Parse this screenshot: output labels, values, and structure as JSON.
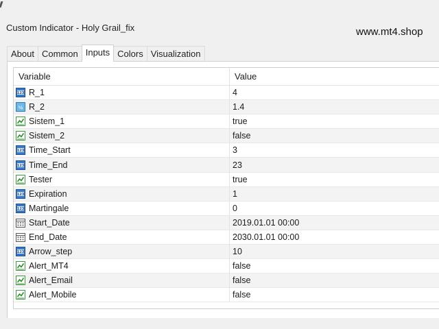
{
  "window": {
    "title": "Custom Indicator - Holy Grail_fix"
  },
  "watermark": "www.mt4.shop",
  "tabs": [
    {
      "label": "About",
      "active": false
    },
    {
      "label": "Common",
      "active": false
    },
    {
      "label": "Inputs",
      "active": true
    },
    {
      "label": "Colors",
      "active": false
    },
    {
      "label": "Visualization",
      "active": false
    }
  ],
  "table": {
    "columns": [
      "Variable",
      "Value"
    ],
    "rows": [
      {
        "icon": "int-icon",
        "name": "R_1",
        "value": "4"
      },
      {
        "icon": "double-icon",
        "name": "R_2",
        "value": "1.4"
      },
      {
        "icon": "bool-icon",
        "name": "Sistem_1",
        "value": "true"
      },
      {
        "icon": "bool-icon",
        "name": "Sistem_2",
        "value": "false"
      },
      {
        "icon": "int-icon",
        "name": "Time_Start",
        "value": "3"
      },
      {
        "icon": "int-icon",
        "name": "Time_End",
        "value": "23"
      },
      {
        "icon": "bool-icon",
        "name": "Tester",
        "value": "true"
      },
      {
        "icon": "int-icon",
        "name": "Expiration",
        "value": "1"
      },
      {
        "icon": "int-icon",
        "name": "Martingale",
        "value": "0"
      },
      {
        "icon": "datetime-icon",
        "name": "Start_Date",
        "value": "2019.01.01 00:00"
      },
      {
        "icon": "datetime-icon",
        "name": "End_Date",
        "value": "2030.01.01 00:00"
      },
      {
        "icon": "int-icon",
        "name": "Arrow_step",
        "value": "10"
      },
      {
        "icon": "bool-icon",
        "name": "Alert_MT4",
        "value": "false"
      },
      {
        "icon": "bool-icon",
        "name": "Alert_Email",
        "value": "false"
      },
      {
        "icon": "bool-icon",
        "name": "Alert_Mobile",
        "value": "false"
      }
    ]
  }
}
